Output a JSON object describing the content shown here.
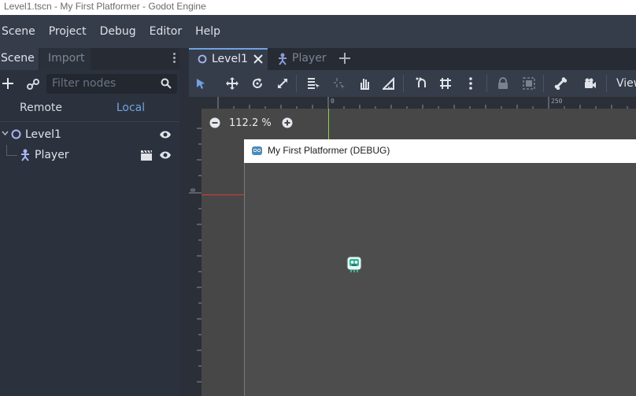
{
  "window": {
    "title": "Level1.tscn - My First Platformer - Godot Engine"
  },
  "menu": [
    "Scene",
    "Project",
    "Debug",
    "Editor",
    "Help"
  ],
  "scene_dock": {
    "tabs": {
      "scene": "Scene",
      "import": "Import"
    },
    "filter_placeholder": "Filter nodes",
    "remote_label": "Remote",
    "local_label": "Local",
    "tree": [
      {
        "name": "Level1",
        "icon": "node2d-icon"
      },
      {
        "name": "Player",
        "icon": "scene-instance-icon"
      }
    ]
  },
  "editor_tabs": {
    "active": "Level1",
    "inactive": "Player"
  },
  "toolbar": {
    "view_label": "View"
  },
  "viewport": {
    "zoom_label": "112.2 %",
    "ruler_marks": {
      "zero": "0",
      "mark_250": "250",
      "left_zero": "0"
    }
  },
  "game_window": {
    "title": "My First Platformer (DEBUG)"
  },
  "colors": {
    "accent": "#6fa3e0",
    "menubar": "#363d4a",
    "viewport": "#474747",
    "guide_green": "#8bd14d",
    "guide_red": "#e03a3a"
  }
}
